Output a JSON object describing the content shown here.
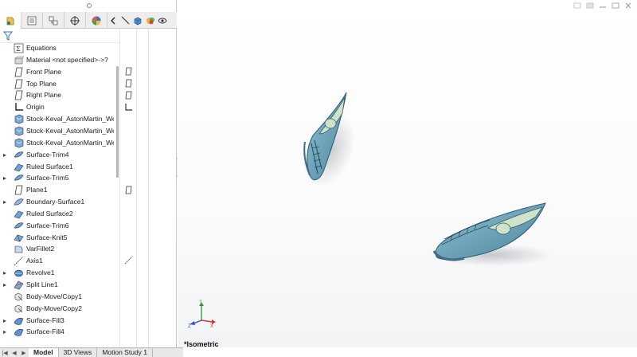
{
  "panel_tabs": [
    "featuremanager-tab",
    "propertymanager-tab",
    "configurationmanager-tab",
    "dimxpert-tab",
    "display-manager-tab"
  ],
  "tree": {
    "items": [
      {
        "label": "Equations",
        "icon": "equations-icon",
        "expandable": false
      },
      {
        "label": "Material <not specified>->?",
        "icon": "material-icon",
        "expandable": false
      },
      {
        "label": "Front Plane",
        "icon": "plane-icon",
        "expandable": false
      },
      {
        "label": "Top Plane",
        "icon": "plane-icon",
        "expandable": false
      },
      {
        "label": "Right Plane",
        "icon": "plane-icon",
        "expandable": false
      },
      {
        "label": "Origin",
        "icon": "origin-icon",
        "expandable": false
      },
      {
        "label": "Stock-Keval_AstonMartin_Wee",
        "icon": "stock-body-icon",
        "expandable": false
      },
      {
        "label": "Stock-Keval_AstonMartin_Wee",
        "icon": "stock-body-icon",
        "expandable": false
      },
      {
        "label": "Stock-Keval_AstonMartin_Wee",
        "icon": "stock-body-icon",
        "expandable": false
      },
      {
        "label": "Surface-Trim4",
        "icon": "surface-trim-icon",
        "expandable": true
      },
      {
        "label": "Ruled Surface1",
        "icon": "ruled-surface-icon",
        "expandable": false
      },
      {
        "label": "Surface-Trim5",
        "icon": "surface-trim-icon",
        "expandable": true
      },
      {
        "label": "Plane1",
        "icon": "plane-icon",
        "expandable": false
      },
      {
        "label": "Boundary-Surface1",
        "icon": "boundary-surface-icon",
        "expandable": true
      },
      {
        "label": "Ruled Surface2",
        "icon": "ruled-surface-icon",
        "expandable": false
      },
      {
        "label": "Surface-Trim6",
        "icon": "surface-trim-icon",
        "expandable": false
      },
      {
        "label": "Surface-Knit5",
        "icon": "surface-knit-icon",
        "expandable": false
      },
      {
        "label": "VarFillet2",
        "icon": "fillet-icon",
        "expandable": false
      },
      {
        "label": "Axis1",
        "icon": "axis-icon",
        "expandable": false
      },
      {
        "label": "Revolve1",
        "icon": "revolve-icon",
        "expandable": true
      },
      {
        "label": "Split Line1",
        "icon": "split-line-icon",
        "expandable": true
      },
      {
        "label": "Body-Move/Copy1",
        "icon": "move-copy-icon",
        "expandable": false
      },
      {
        "label": "Body-Move/Copy2",
        "icon": "move-copy-icon",
        "expandable": false
      },
      {
        "label": "Surface-Fill3",
        "icon": "surface-fill-icon",
        "expandable": true
      },
      {
        "label": "Surface-Fill4",
        "icon": "surface-fill-icon",
        "expandable": true
      }
    ]
  },
  "bottom_tabs": [
    "Model",
    "3D Views",
    "Motion Study 1"
  ],
  "viewport": {
    "view_label": "*Isometric",
    "triad_axes": {
      "x": "X",
      "y": "Y",
      "z": "Z"
    }
  },
  "colors": {
    "body_fill": "#6fa8c0",
    "body_dark": "#3e6f86",
    "glass": "#cfe3c8",
    "triad_x": "#d0342c",
    "triad_y": "#2f9e3a",
    "triad_z": "#2b55c6"
  }
}
